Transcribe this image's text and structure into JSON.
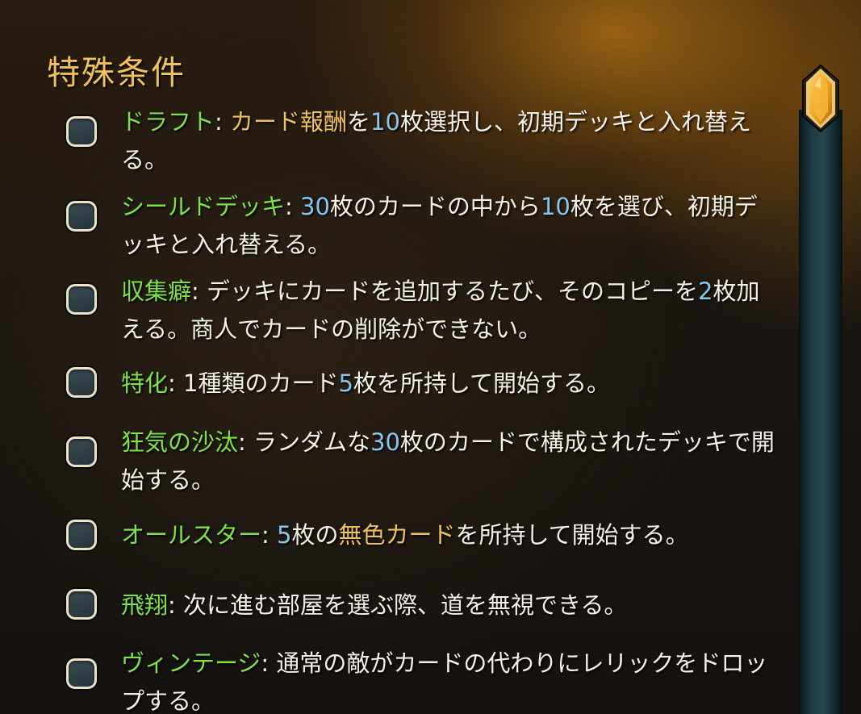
{
  "title": "特殊条件",
  "items": [
    {
      "segments": [
        {
          "text": "ドラフト",
          "color": "green"
        },
        {
          "text": ": ",
          "color": "white"
        },
        {
          "text": "カード報酬",
          "color": "gold"
        },
        {
          "text": "を",
          "color": "white"
        },
        {
          "text": "10",
          "color": "blue"
        },
        {
          "text": "枚選択し、初期デッキと入れ替える。",
          "color": "white"
        }
      ]
    },
    {
      "segments": [
        {
          "text": "シールドデッキ",
          "color": "green"
        },
        {
          "text": ": ",
          "color": "white"
        },
        {
          "text": "30",
          "color": "blue"
        },
        {
          "text": "枚のカードの中から",
          "color": "white"
        },
        {
          "text": "10",
          "color": "blue"
        },
        {
          "text": "枚を選び、初期デッキと入れ替える。",
          "color": "white"
        }
      ]
    },
    {
      "segments": [
        {
          "text": "収集癖",
          "color": "green"
        },
        {
          "text": ": デッキにカードを追加するたび、そのコピーを",
          "color": "white"
        },
        {
          "text": "2",
          "color": "blue"
        },
        {
          "text": "枚加える。商人でカードの削除ができない。",
          "color": "white"
        }
      ]
    },
    {
      "segments": [
        {
          "text": "特化",
          "color": "green"
        },
        {
          "text": ": 1種類のカード",
          "color": "white"
        },
        {
          "text": "5",
          "color": "blue"
        },
        {
          "text": "枚を所持して開始する。",
          "color": "white"
        }
      ]
    },
    {
      "segments": [
        {
          "text": "狂気の沙汰",
          "color": "green"
        },
        {
          "text": ": ランダムな",
          "color": "white"
        },
        {
          "text": "30",
          "color": "blue"
        },
        {
          "text": "枚のカードで構成されたデッキで開始する。",
          "color": "white"
        }
      ]
    },
    {
      "segments": [
        {
          "text": "オールスター",
          "color": "green"
        },
        {
          "text": ": ",
          "color": "white"
        },
        {
          "text": "5",
          "color": "blue"
        },
        {
          "text": "枚の",
          "color": "white"
        },
        {
          "text": "無色カード",
          "color": "gold"
        },
        {
          "text": "を所持して開始する。",
          "color": "white"
        }
      ]
    },
    {
      "segments": [
        {
          "text": "飛翔",
          "color": "green"
        },
        {
          "text": ": 次に進む部屋を選ぶ際、道を無視できる。",
          "color": "white"
        }
      ]
    },
    {
      "segments": [
        {
          "text": "ヴィンテージ",
          "color": "green"
        },
        {
          "text": ": 通常の敵がカードの代わりにレリックをドロップする。",
          "color": "white"
        }
      ]
    }
  ],
  "colors": {
    "green": "#7fe04a",
    "gold": "#efc15a",
    "blue": "#86c6ef",
    "white": "#f3f0e8"
  }
}
